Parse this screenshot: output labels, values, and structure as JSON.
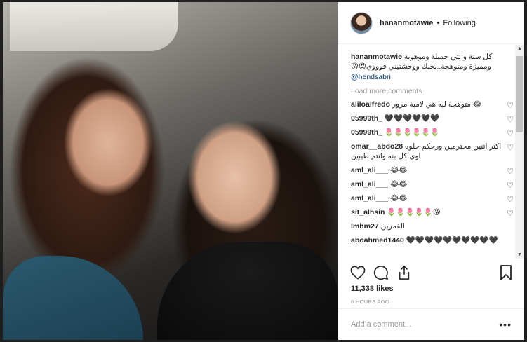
{
  "post": {
    "username": "hananmotawie",
    "follow_status": "Following",
    "caption_user": "hananmotawie",
    "caption_text": "كل سنة وانتي جميلة وموهوبة ومميزة ومتوهجة..بحبك ووحشتيني قوووي😍😘",
    "caption_mention": "@hendsabri",
    "load_more": "Load more comments",
    "likes": "11,338 likes",
    "time": "8 HOURS AGO",
    "add_comment_placeholder": "Add a comment...",
    "more_label": "•••"
  },
  "comments": [
    {
      "user": "aliloalfredo",
      "text": "متوهجة ليه هي لامبة مرور 😂"
    },
    {
      "user": "05999th_",
      "text": "🖤🖤🖤🖤🖤🖤"
    },
    {
      "user": "05999th_",
      "text": "🌷🌷🌷🌷🌷🌷"
    },
    {
      "user": "omar__abdo28",
      "text": "اكتر اتنين محترمين ورحكم حلوه اوي كل بنه وانتم طيبين"
    },
    {
      "user": "aml_ali___",
      "text": "😂😂"
    },
    {
      "user": "aml_ali___",
      "text": "😂😂"
    },
    {
      "user": "aml_ali___",
      "text": "😂😂"
    },
    {
      "user": "sit_alhsin",
      "text": "🌷🌷🌷🌷🌷😘"
    },
    {
      "user": "lmhm27",
      "text": "القمرين"
    },
    {
      "user": "aboahmed1440",
      "text": "🖤🖤🖤🖤🖤🖤🖤🖤🖤🖤"
    }
  ],
  "icons": {
    "like": "heart-icon",
    "comment": "comment-icon",
    "share": "share-icon",
    "save": "bookmark-icon",
    "comment_like": "heart-icon"
  }
}
